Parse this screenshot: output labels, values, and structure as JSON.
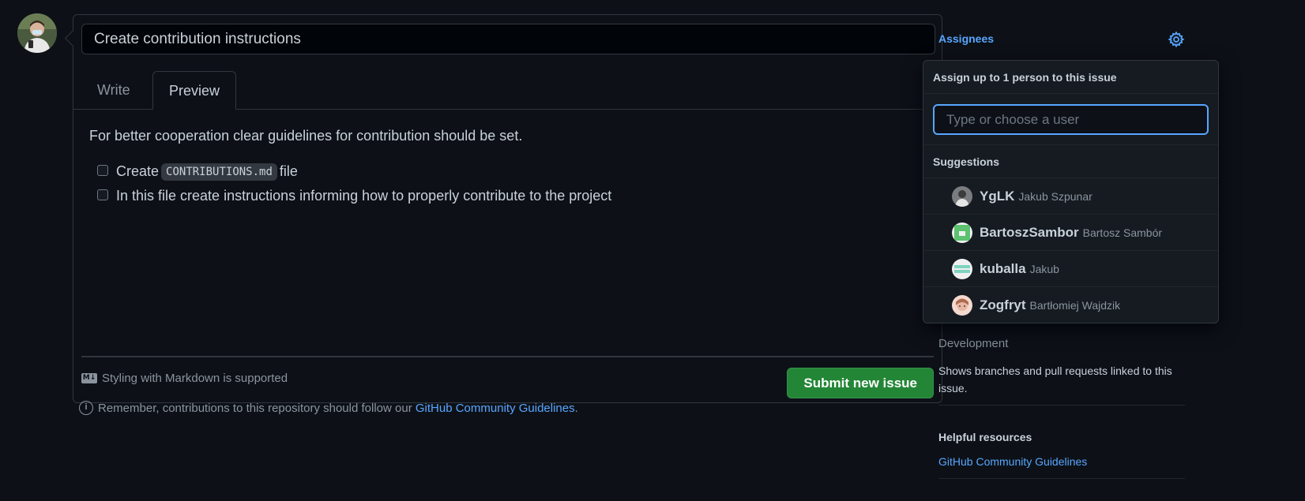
{
  "issue": {
    "title_value": "Create contribution instructions",
    "tabs": [
      {
        "label": "Write",
        "active": false
      },
      {
        "label": "Preview",
        "active": true
      }
    ],
    "preview": {
      "paragraph": "For better cooperation clear guidelines for contribution should be set.",
      "task1_before": "Create",
      "task1_code": "CONTRIBUTIONS.md",
      "task1_after": "file",
      "task2": "In this file create instructions informing how to properly contribute to the project"
    },
    "markdown_note": "Styling with Markdown is supported",
    "markdown_icon_text": "M↓",
    "submit_label": "Submit new issue",
    "guidelines_note_before": "Remember, contributions to this repository should follow our",
    "guidelines_note_link": "GitHub Community Guidelines",
    "guidelines_note_after": "."
  },
  "sidebar": {
    "assignees_label": "Assignees",
    "development_label": "Development",
    "development_text": "Shows branches and pull requests linked to this issue.",
    "helpful_label": "Helpful resources",
    "helpful_link": "GitHub Community Guidelines"
  },
  "assign_dropdown": {
    "header": "Assign up to 1 person to this issue",
    "input_placeholder": "Type or choose a user",
    "input_value": "",
    "suggestions_label": "Suggestions",
    "users": [
      {
        "login": "YgLK",
        "name": "Jakub Szpunar"
      },
      {
        "login": "BartoszSambor",
        "name": "Bartosz Sambór"
      },
      {
        "login": "kuballa",
        "name": "Jakub"
      },
      {
        "login": "Zogfryt",
        "name": "Bartłomiej Wajdzik"
      }
    ]
  },
  "colors": {
    "background": "#0d1117",
    "accent": "#58a6ff",
    "submit_green": "#238636",
    "border": "#30363d"
  }
}
